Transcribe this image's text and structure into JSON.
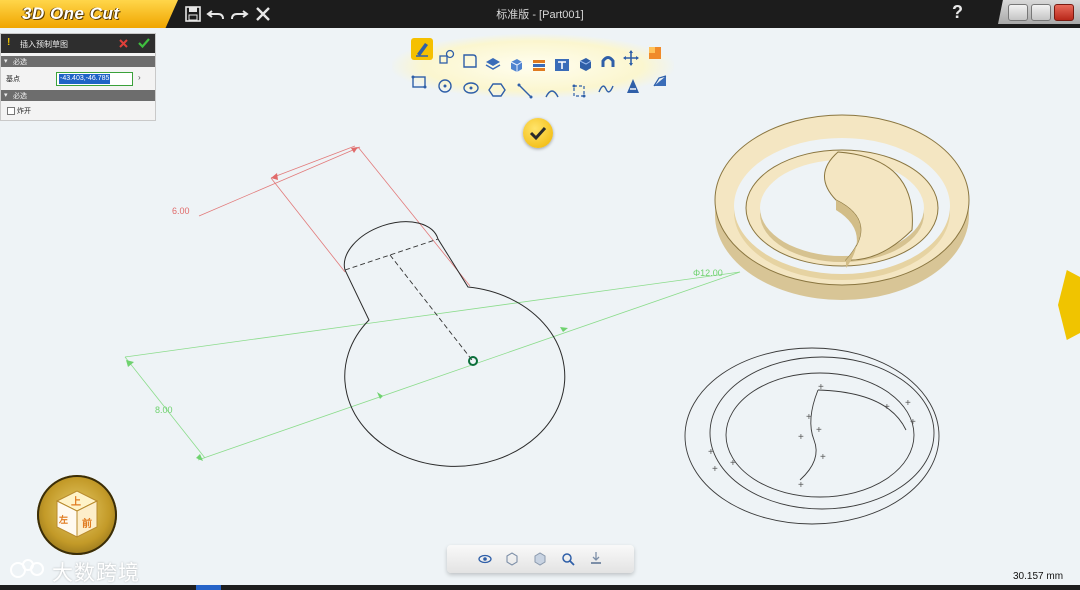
{
  "app": {
    "logo_text": "3D One Cut",
    "window_title": "标准版 - [Part001]",
    "help_label": "?"
  },
  "panel": {
    "title": "插入预制草图",
    "section_required": "必选",
    "field_label": "基点",
    "field_value": "-43.403,-46.785",
    "section_optional": "必选",
    "checkbox_label": "炸开"
  },
  "sketch": {
    "dimension_1": "6.00",
    "dimension_2": "8.00",
    "dimension_3": "Φ12.00"
  },
  "status": {
    "measure": "30.157 mm"
  },
  "watermark": {
    "text": "大数跨境"
  },
  "colors": {
    "accent": "#f0b400",
    "dimension_red": "#e06a6a",
    "dimension_green": "#6fd26f",
    "solid_body": "#f4e6c2"
  }
}
